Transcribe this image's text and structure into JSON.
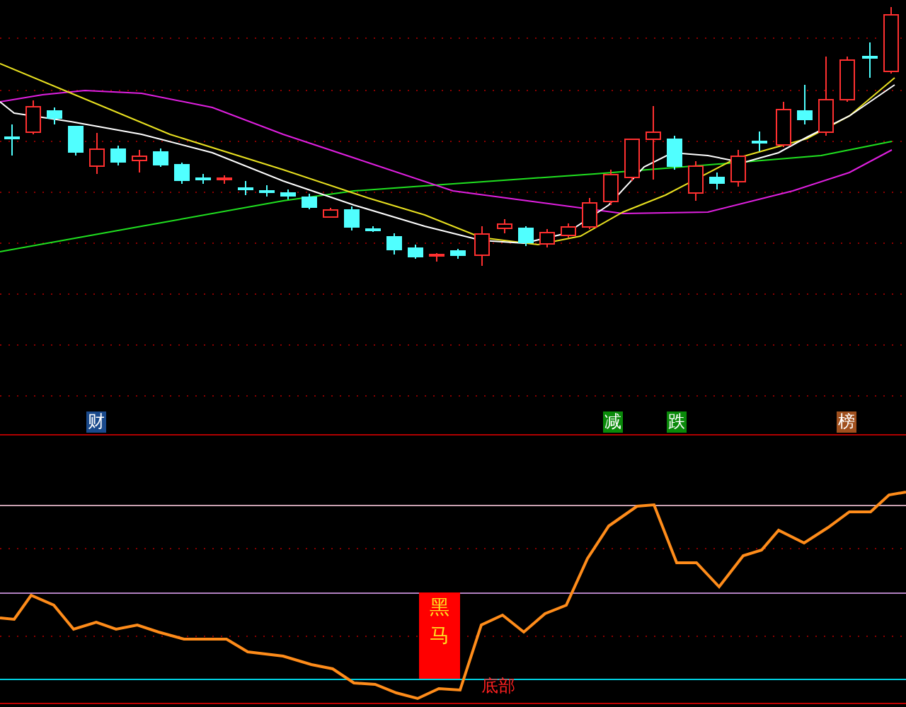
{
  "price_chart": {
    "markers": [
      {
        "text": "财",
        "color": "#1a4a8c"
      },
      {
        "text": "减",
        "color": "#0a8a0a"
      },
      {
        "text": "跌",
        "color": "#0a8a0a"
      },
      {
        "text": "榜",
        "color": "#a0501e"
      }
    ]
  },
  "indicator_chart": {
    "signal": {
      "text": "黑马"
    },
    "bottom_label": {
      "text": "底部"
    }
  }
}
